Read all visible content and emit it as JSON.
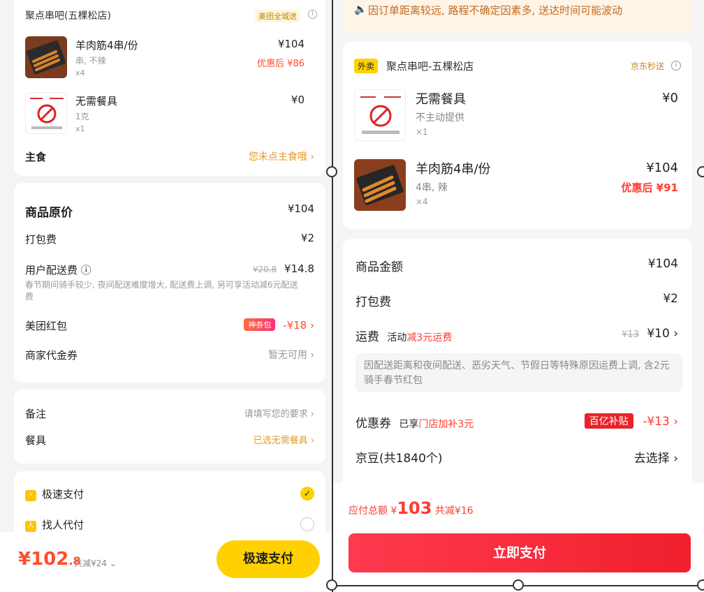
{
  "left": {
    "shop": {
      "name": "聚点串吧(五棵松店)",
      "badge": "美团全城送",
      "info_icon": "ⓘ"
    },
    "items": [
      {
        "name": "羊肉筋4串/份",
        "spec": "串, 不辣",
        "qty": "x4",
        "price": "¥104",
        "discount": "优惠后 ¥86"
      },
      {
        "name": "无需餐具",
        "spec": "1克",
        "qty": "x1",
        "price": "¥0"
      }
    ],
    "staple": {
      "label": "主食",
      "value": "您未点主食哦 ›"
    },
    "fees": {
      "original": {
        "label": "商品原价",
        "value": "¥104"
      },
      "packing": {
        "label": "打包费",
        "value": "¥2"
      },
      "delivery": {
        "label": "用户配送费 ⓘ",
        "old": "¥20.8",
        "value": "¥14.8",
        "note": "春节期间骑手较少, 夜间配送难度增大, 配送费上调, 另可享活动减6元配送费"
      },
      "red_packet": {
        "label": "美团红包",
        "tag": "神券包",
        "value": "-¥18 ›"
      },
      "voucher": {
        "label": "商家代金券",
        "value": "暂无可用 ›"
      }
    },
    "note": {
      "remark": {
        "label": "备注",
        "value": "请填写您的要求 ›"
      },
      "tableware": {
        "label": "餐具",
        "value": "已选无需餐具 ›"
      }
    },
    "payment": {
      "fast": {
        "label": "极速支付",
        "check": "✓"
      },
      "friend": {
        "label": "找人代付"
      }
    },
    "bottom": {
      "total_main": "¥102",
      "total_dec": ".8",
      "saved": "共减¥24 ⌄",
      "button": "极速支付"
    }
  },
  "right": {
    "notice": {
      "icon": "🔈",
      "text": "因订单距离较远, 路程不确定因素多, 送达时间可能波动"
    },
    "shop": {
      "type_tag": "外卖",
      "name": "聚点串吧-五棵松店",
      "badge": "京东秒送",
      "info_icon": "ⓘ"
    },
    "items": [
      {
        "name": "无需餐具",
        "spec": "不主动提供",
        "qty": "×1",
        "price": "¥0"
      },
      {
        "name": "羊肉筋4串/份",
        "spec": "4串, 辣",
        "qty": "×4",
        "price": "¥104",
        "discount": "优惠后 ¥91"
      }
    ],
    "fees": {
      "goods": {
        "label": "商品金额",
        "value": "¥104"
      },
      "packing": {
        "label": "打包费",
        "value": "¥2"
      },
      "shipping": {
        "label": "运费",
        "activity_prefix": "活动",
        "activity_red": "减3元运费",
        "old": "¥13",
        "value": "¥10 ›"
      },
      "explain": "因配送距离和夜间配送、恶劣天气、节假日等特殊原因运费上调, 含2元骑手春节红包",
      "coupon": {
        "label": "优惠券",
        "enjoyed_prefix": "已享",
        "enjoyed_red": "门店加补3元",
        "tag": "百亿补贴",
        "value": "-¥13 ›"
      },
      "jd_beans": {
        "label": "京豆(共1840个)",
        "value": "去选择 ›"
      }
    },
    "bottom": {
      "sum_label": "应付总额 ¥",
      "sum_value": "103",
      "saved": " 共减¥16",
      "button": "立即支付"
    }
  }
}
